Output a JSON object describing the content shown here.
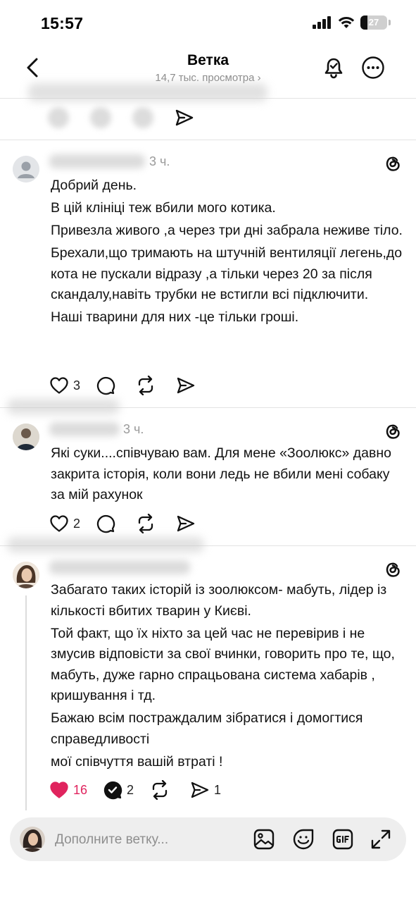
{
  "status_bar": {
    "time": "15:57",
    "battery": "27",
    "battery_level": 0.27
  },
  "header": {
    "title": "Ветка",
    "subtitle": "14,7 тыс. просмотра ›"
  },
  "posts": [
    {
      "time": "3 ч.",
      "paragraphs": [
        "Добрий день.",
        "В цій клініці теж вбили мого котика.",
        "Привезла живого ,а через три дні забрала неживе тіло.",
        "Брехали,що тримають на штучній вентиляції легень,до кота не пускали відразу ,а тільки через 20 за після скандалу,навіть трубки не встигли всі підключити.",
        "Наші тварини для них -це тільки гроші."
      ],
      "likes": "3",
      "replies": "",
      "reposts": "",
      "shares": ""
    },
    {
      "time": "3 ч.",
      "paragraphs": [
        "Які суки....співчуваю вам. Для мене «Зоолюкс» давно закрита історія, коли вони ледь не вбили мені собаку за мій рахунок"
      ],
      "likes": "2",
      "replies": "",
      "reposts": "",
      "shares": ""
    },
    {
      "time": "",
      "paragraphs": [
        "Забагато таких історій із зоолюксом- мабуть, лідер із кількості вбитих тварин у Києві.",
        "Той факт, що їх ніхто за цей час не перевірив і не змусив відповісти за свої вчинки, говорить про те, що, мабуть, дуже гарно спрацьована система хабарів , кришування і тд.",
        "Бажаю всім постраждалим зібратися і домогтися справедливості",
        "мої співчуття вашій втраті !"
      ],
      "likes": "16",
      "replies": "2",
      "reposts": "",
      "shares": "1"
    }
  ],
  "composer": {
    "placeholder": "Дополните ветку..."
  },
  "colors": {
    "like_active": "#e0245e",
    "text_secondary": "#8a8a8a",
    "composer_bg": "#eeeeee"
  },
  "icons": [
    "back-chevron-icon",
    "bell-icon",
    "more-icon",
    "heart-icon",
    "comment-icon",
    "repost-icon",
    "share-icon",
    "threads-logo-icon",
    "image-icon",
    "sticker-icon",
    "gif-icon",
    "expand-icon"
  ]
}
